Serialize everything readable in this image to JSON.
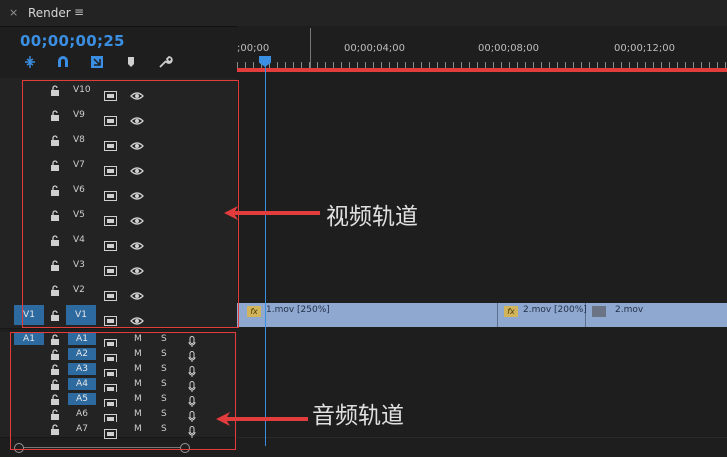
{
  "panel": {
    "close": "×",
    "title": "Render",
    "menu": "≡"
  },
  "timecode": "00;00;00;25",
  "toolbar": [
    "insert-icon",
    "magnet-snap-icon",
    "linked-selection-icon",
    "marker-icon",
    "wrench-icon"
  ],
  "ruler": {
    "labels": [
      ";00;00",
      "00;00;04;00",
      "00;00;08;00",
      "00;00;12;00"
    ]
  },
  "video_tracks": [
    "V10",
    "V9",
    "V8",
    "V7",
    "V6",
    "V5",
    "V4",
    "V3",
    "V2"
  ],
  "v1": {
    "source": "V1",
    "target": "V1"
  },
  "audio_tracks": [
    "A1",
    "A2",
    "A3",
    "A4",
    "A5",
    "A6",
    "A7"
  ],
  "a1_source": "A1",
  "audio_buttons": {
    "mute": "M",
    "solo": "S"
  },
  "clips": [
    {
      "label": "1.mov [250%]",
      "fx": "fx"
    },
    {
      "label": "2.mov [200%]",
      "fx": "fx"
    },
    {
      "label": "2.mov",
      "fx": ""
    }
  ],
  "annotations": {
    "video": "视频轨道",
    "audio": "音频轨道"
  },
  "colors": {
    "accent": "#3b8fe3",
    "annotation": "#e23c3c",
    "clip": "#8fa8cf"
  }
}
